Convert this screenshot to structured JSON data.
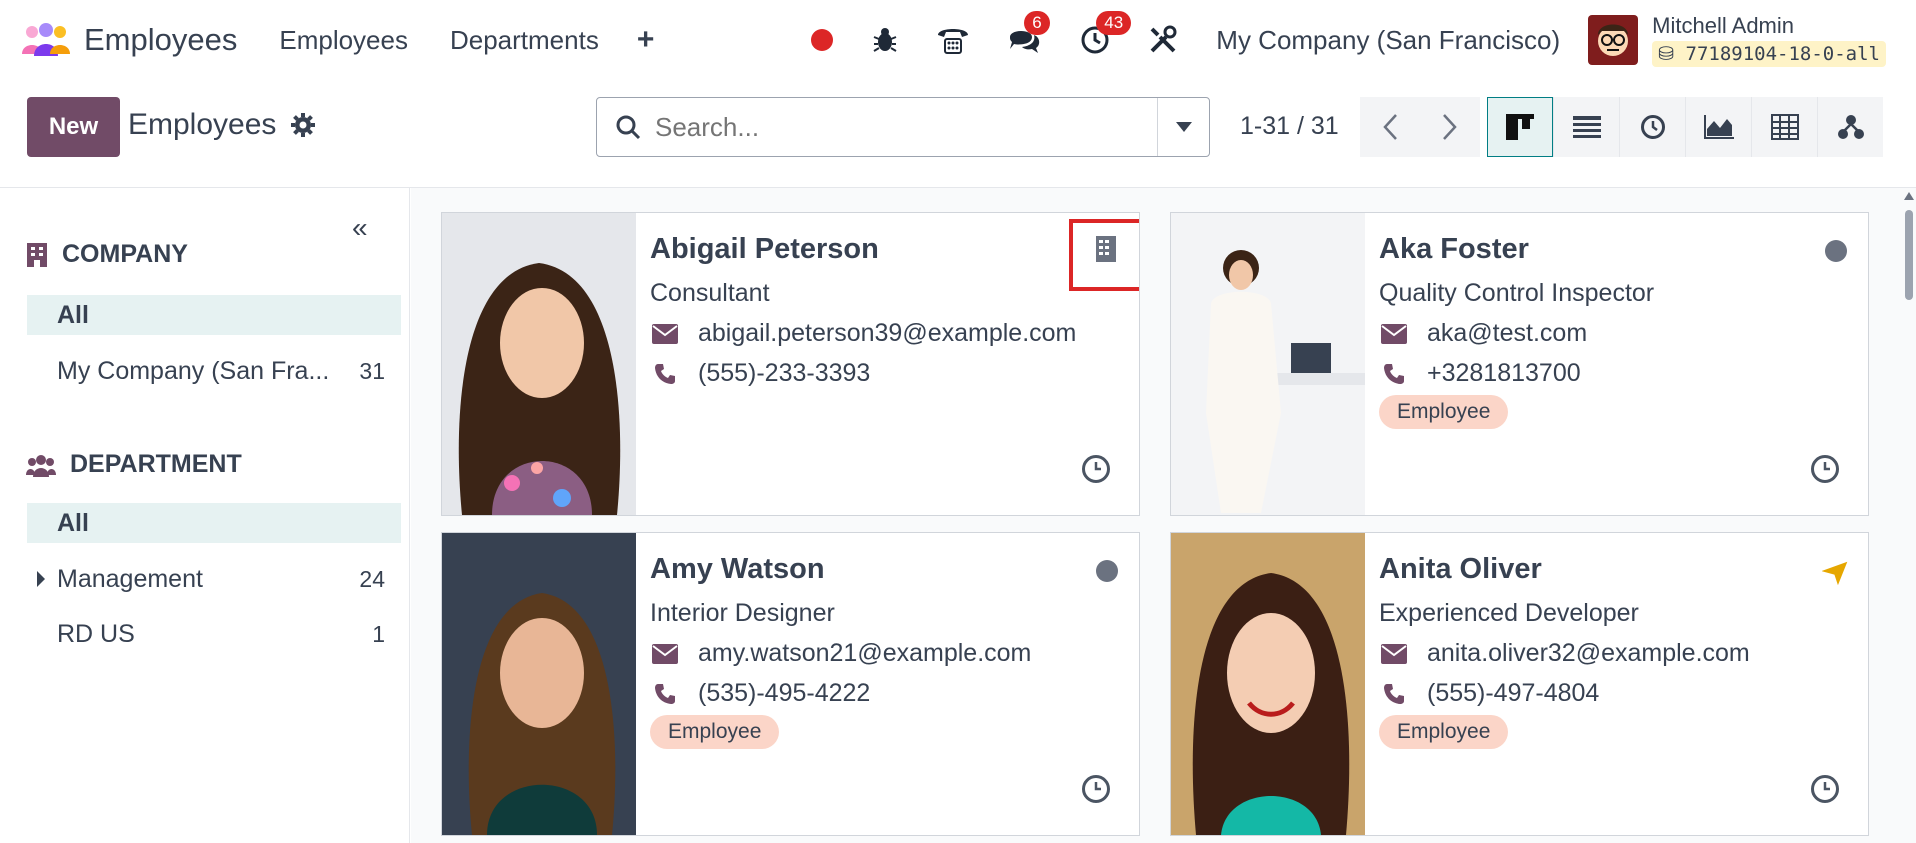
{
  "navbar": {
    "app_title": "Employees",
    "menu": [
      "Employees",
      "Departments"
    ],
    "plus": "+",
    "messages_count": "6",
    "activities_count": "43",
    "company": "My Company (San Francisco)",
    "user_name": "Mitchell Admin",
    "db_name": "77189104-18-0-all"
  },
  "control": {
    "new_label": "New",
    "breadcrumb": "Employees",
    "search_placeholder": "Search...",
    "pager": "1-31 / 31",
    "views": [
      "kanban-icon",
      "list-icon",
      "activity-icon",
      "graph-icon",
      "pivot-icon",
      "hierarchy-icon"
    ]
  },
  "sidebar": {
    "company_title": "COMPANY",
    "company_items": [
      {
        "label": "All",
        "count": ""
      },
      {
        "label": "My Company (San Fra...",
        "count": "31"
      }
    ],
    "department_title": "DEPARTMENT",
    "department_items": [
      {
        "label": "All",
        "count": ""
      },
      {
        "label": "Management",
        "count": "24"
      },
      {
        "label": "RD US",
        "count": "1"
      }
    ]
  },
  "employees": [
    {
      "name": "Abigail Peterson",
      "job": "Consultant",
      "email": "abigail.peterson39@example.com",
      "phone": "(555)-233-3393",
      "tag": "",
      "status": "building-icon"
    },
    {
      "name": "Aka Foster",
      "job": "Quality Control Inspector",
      "email": "aka@test.com",
      "phone": "+3281813700",
      "tag": "Employee",
      "status": "offline-dot"
    },
    {
      "name": "Amy Watson",
      "job": "Interior Designer",
      "email": "amy.watson21@example.com",
      "phone": "(535)-495-4222",
      "tag": "Employee",
      "status": "offline-dot"
    },
    {
      "name": "Anita Oliver",
      "job": "Experienced Developer",
      "email": "anita.oliver32@example.com",
      "phone": "(555)-497-4804",
      "tag": "Employee",
      "status": "plane-icon"
    }
  ],
  "colors": {
    "brand": "#714b67",
    "accent": "#017e84",
    "badge": "#dc2626",
    "tag": "#fbd5c8"
  }
}
